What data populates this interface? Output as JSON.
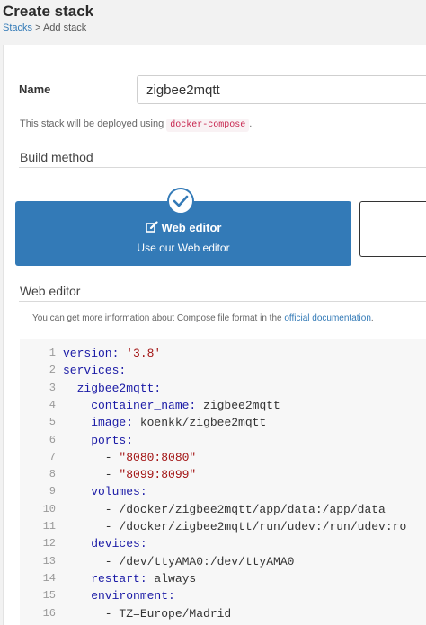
{
  "header": {
    "title": "Create stack",
    "breadcrumb": {
      "parent": "Stacks",
      "separator": " > ",
      "current": "Add stack"
    }
  },
  "form": {
    "name_label": "Name",
    "name_value": "zigbee2mqtt",
    "deploy_note_prefix": "This stack will be deployed using ",
    "deploy_tool": "docker-compose",
    "deploy_note_suffix": "."
  },
  "build_method": {
    "section_title": "Build method",
    "selected_option": {
      "title": "Web editor",
      "subtitle": "Use our Web editor",
      "icon": "edit-icon",
      "selected_icon": "check-icon"
    },
    "accent_color": "#337ab7"
  },
  "web_editor": {
    "section_title": "Web editor",
    "docs_note_prefix": "You can get more information about Compose file format in the ",
    "docs_link": "official documentation",
    "docs_note_suffix": ".",
    "lines": [
      {
        "num": "1",
        "tokens": [
          {
            "t": "version: ",
            "c": "key"
          },
          {
            "t": "'3.8'",
            "c": "str"
          }
        ]
      },
      {
        "num": "2",
        "tokens": [
          {
            "t": "services:",
            "c": "key"
          }
        ]
      },
      {
        "num": "3",
        "tokens": [
          {
            "t": "  zigbee2mqtt:",
            "c": "key"
          }
        ]
      },
      {
        "num": "4",
        "tokens": [
          {
            "t": "    container_name: ",
            "c": "key"
          },
          {
            "t": "zigbee2mqtt",
            "c": "plain"
          }
        ]
      },
      {
        "num": "5",
        "tokens": [
          {
            "t": "    image: ",
            "c": "key"
          },
          {
            "t": "koenkk/zigbee2mqtt",
            "c": "plain"
          }
        ]
      },
      {
        "num": "6",
        "tokens": [
          {
            "t": "    ports:",
            "c": "key"
          }
        ]
      },
      {
        "num": "7",
        "tokens": [
          {
            "t": "      - ",
            "c": "plain"
          },
          {
            "t": "\"8080:8080\"",
            "c": "str"
          }
        ]
      },
      {
        "num": "8",
        "tokens": [
          {
            "t": "      - ",
            "c": "plain"
          },
          {
            "t": "\"8099:8099\"",
            "c": "str"
          }
        ]
      },
      {
        "num": "9",
        "tokens": [
          {
            "t": "    volumes:",
            "c": "key"
          }
        ]
      },
      {
        "num": "10",
        "tokens": [
          {
            "t": "      - /docker/zigbee2mqtt/app/data:/app/data",
            "c": "plain"
          }
        ]
      },
      {
        "num": "11",
        "tokens": [
          {
            "t": "      - /docker/zigbee2mqtt/run/udev:/run/udev:ro",
            "c": "plain"
          }
        ]
      },
      {
        "num": "12",
        "tokens": [
          {
            "t": "    devices:",
            "c": "key"
          }
        ]
      },
      {
        "num": "13",
        "tokens": [
          {
            "t": "      - /dev/ttyAMA0:/dev/ttyAMA0",
            "c": "plain"
          }
        ]
      },
      {
        "num": "14",
        "tokens": [
          {
            "t": "    restart: ",
            "c": "key"
          },
          {
            "t": "always",
            "c": "plain"
          }
        ]
      },
      {
        "num": "15",
        "tokens": [
          {
            "t": "    environment:",
            "c": "key"
          }
        ]
      },
      {
        "num": "16",
        "tokens": [
          {
            "t": "      - TZ=Europe/Madrid",
            "c": "plain"
          }
        ]
      }
    ]
  }
}
